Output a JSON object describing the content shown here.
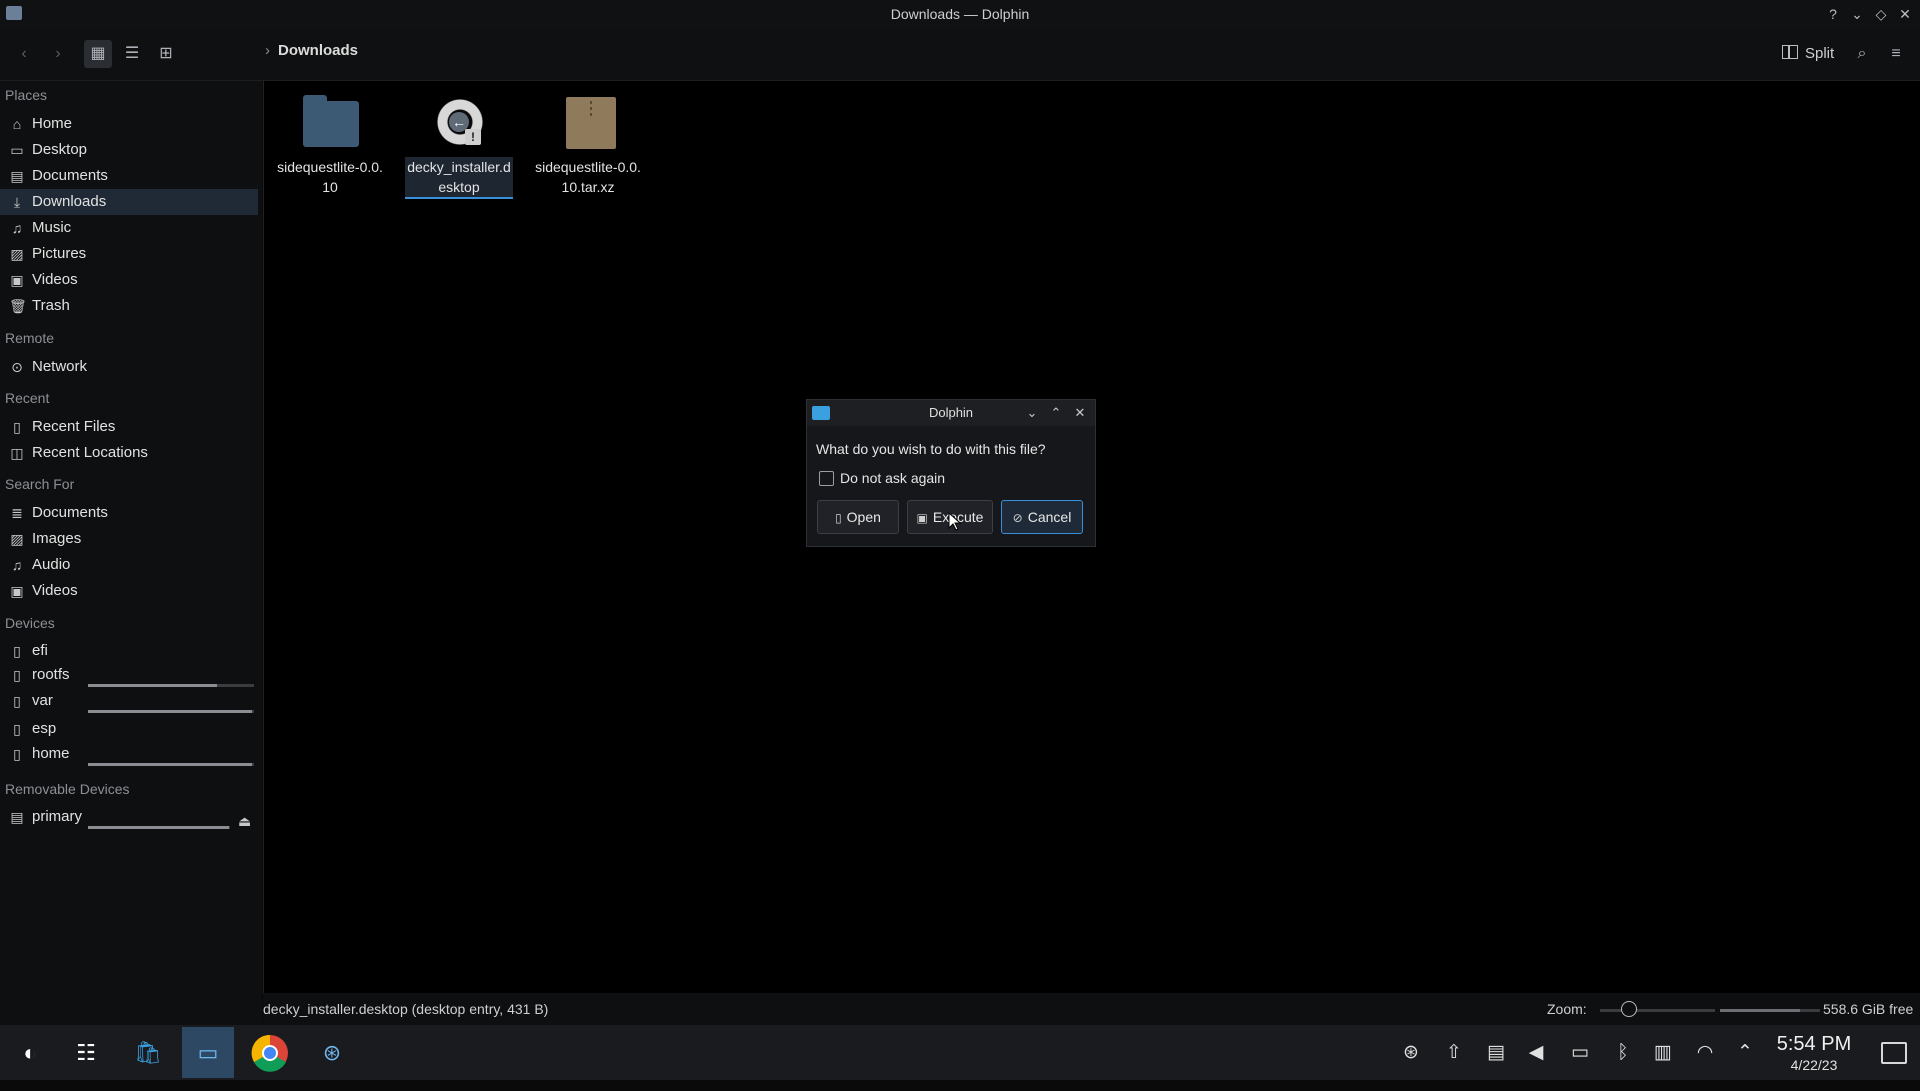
{
  "window": {
    "title": "Downloads — Dolphin",
    "controls": [
      "help-icon",
      "minimize-icon",
      "maximize-icon",
      "close-icon"
    ]
  },
  "toolbar": {
    "breadcrumb": "Downloads",
    "split_label": "Split",
    "view_modes": [
      "icons-view-icon",
      "compact-view-icon",
      "details-view-icon"
    ]
  },
  "sidebar": {
    "sections": {
      "places": "Places",
      "remote": "Remote",
      "recent": "Recent",
      "search_for": "Search For",
      "devices": "Devices",
      "removable": "Removable Devices"
    },
    "places": [
      {
        "label": "Home",
        "icon": "home-icon"
      },
      {
        "label": "Desktop",
        "icon": "desktop-icon"
      },
      {
        "label": "Documents",
        "icon": "documents-icon"
      },
      {
        "label": "Downloads",
        "icon": "download-icon",
        "selected": true
      },
      {
        "label": "Music",
        "icon": "music-icon"
      },
      {
        "label": "Pictures",
        "icon": "pictures-icon"
      },
      {
        "label": "Videos",
        "icon": "videos-icon"
      },
      {
        "label": "Trash",
        "icon": "trash-icon"
      }
    ],
    "remote": [
      {
        "label": "Network",
        "icon": "network-icon"
      }
    ],
    "recent": [
      {
        "label": "Recent Files",
        "icon": "recent-files-icon"
      },
      {
        "label": "Recent Locations",
        "icon": "recent-locations-icon"
      }
    ],
    "search_for": [
      {
        "label": "Documents",
        "icon": "documents-icon"
      },
      {
        "label": "Images",
        "icon": "images-icon"
      },
      {
        "label": "Audio",
        "icon": "audio-icon"
      },
      {
        "label": "Videos",
        "icon": "videos-icon"
      }
    ],
    "devices": [
      {
        "label": "efi",
        "icon": "drive-icon"
      },
      {
        "label": "rootfs",
        "icon": "drive-icon",
        "usage": 0.78
      },
      {
        "label": "var",
        "icon": "drive-icon",
        "usage": 0.99
      },
      {
        "label": "esp",
        "icon": "drive-icon"
      },
      {
        "label": "home",
        "icon": "drive-icon",
        "usage": 0.99
      }
    ],
    "removable": [
      {
        "label": "primary",
        "icon": "sd-card-icon",
        "usage": 0.99
      }
    ]
  },
  "files": [
    {
      "name": "sidequestlite-0.0.10",
      "type": "folder",
      "icon": "folder-icon"
    },
    {
      "name": "decky_installer.desktop",
      "type": "desktop-entry",
      "icon": "desktop-entry-icon",
      "selected": true
    },
    {
      "name": "sidequestlite-0.0.10.tar.xz",
      "type": "archive",
      "icon": "archive-icon"
    }
  ],
  "statusbar": {
    "text": "decky_installer.desktop (desktop entry, 431 B)",
    "zoom_label": "Zoom:",
    "zoom_level": 0.25,
    "free_space": "558.6 GiB free",
    "space_used": 0.8
  },
  "dialog": {
    "title": "Dolphin",
    "question": "What do you wish to do with this file?",
    "checkbox_label": "Do not ask again",
    "checkbox_checked": false,
    "buttons": {
      "open": "Open",
      "execute": "Execute",
      "cancel": "Cancel"
    }
  },
  "taskbar": {
    "apps": [
      "steamos-menu-icon",
      "settings-icon",
      "discover-store-icon",
      "dolphin-icon",
      "chrome-icon",
      "steam-icon"
    ],
    "tray": [
      "steam-tray-icon",
      "update-icon",
      "clipboard-icon",
      "volume-icon",
      "battery-icon",
      "bluetooth-icon",
      "sd-card-tray-icon",
      "wifi-icon",
      "expand-tray-icon"
    ],
    "time": "5:54 PM",
    "date": "4/22/23"
  },
  "colors": {
    "accent": "#3a8fd9",
    "selection": "#1f2a36",
    "background": "#000000"
  }
}
